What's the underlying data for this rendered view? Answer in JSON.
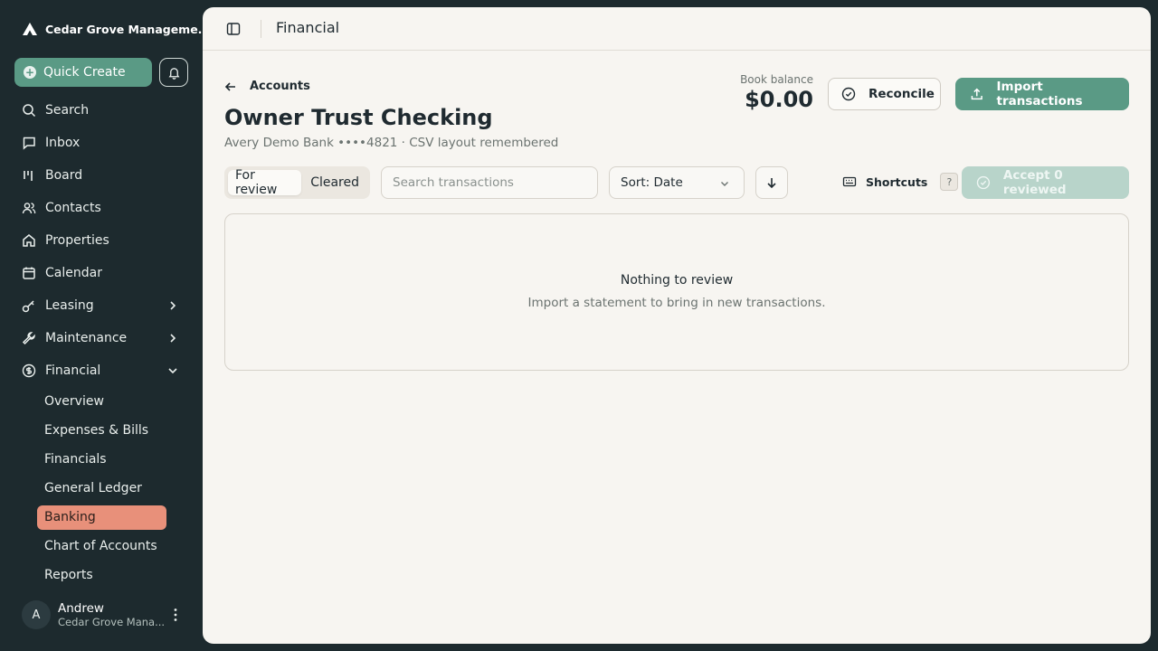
{
  "sidebar": {
    "brand": "Cedar Grove Manageme...",
    "quick_create": "Quick Create",
    "nav": [
      {
        "label": "Search"
      },
      {
        "label": "Inbox"
      },
      {
        "label": "Board"
      },
      {
        "label": "Contacts"
      },
      {
        "label": "Properties"
      },
      {
        "label": "Calendar"
      },
      {
        "label": "Leasing"
      },
      {
        "label": "Maintenance"
      },
      {
        "label": "Financial"
      }
    ],
    "financial_sub": [
      {
        "label": "Overview"
      },
      {
        "label": "Expenses & Bills"
      },
      {
        "label": "Financials"
      },
      {
        "label": "General Ledger"
      },
      {
        "label": "Banking"
      },
      {
        "label": "Chart of Accounts"
      },
      {
        "label": "Reports"
      }
    ],
    "user": {
      "initial": "A",
      "name": "Andrew",
      "org": "Cedar Grove Mana..."
    }
  },
  "topbar": {
    "title": "Financial"
  },
  "account": {
    "back_label": "Accounts",
    "title": "Owner Trust Checking",
    "subtitle": "Avery Demo Bank ••••4821 · CSV layout remembered",
    "balance_label": "Book balance",
    "balance_value": "$0.00"
  },
  "actions": {
    "reconcile": "Reconcile",
    "import": "Import transactions"
  },
  "toolbar": {
    "tab_review": "For review",
    "tab_cleared": "Cleared",
    "search_placeholder": "Search transactions",
    "sort_label": "Sort: Date",
    "shortcuts_label": "Shortcuts",
    "shortcuts_key": "?",
    "accept_label": "Accept 0 reviewed"
  },
  "empty": {
    "heading": "Nothing to review",
    "text": "Import a statement to bring in new transactions."
  },
  "colors": {
    "accent": "#5a9a85",
    "active_nav": "#e8907a",
    "sidebar_bg": "#1d2a2e",
    "panel_bg": "#f7f5f1"
  }
}
